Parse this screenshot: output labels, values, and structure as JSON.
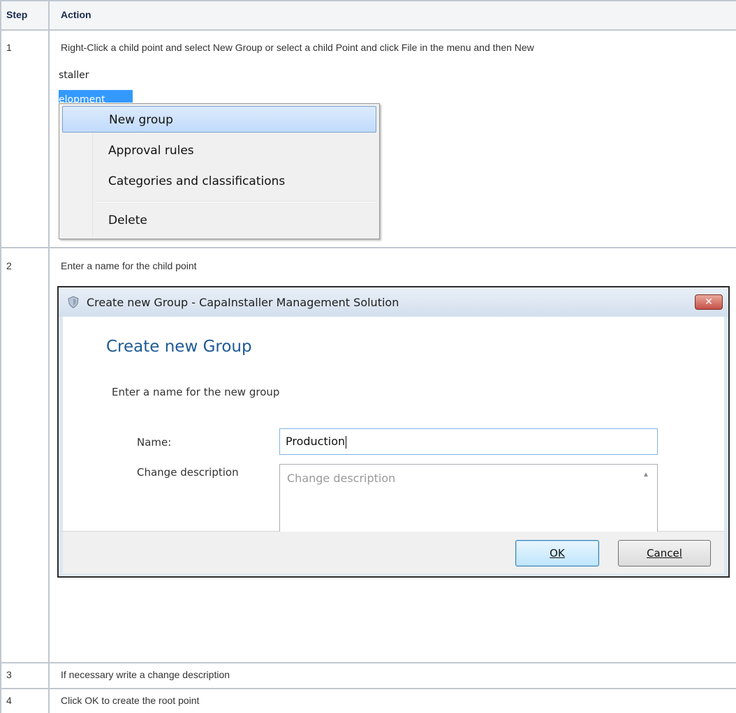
{
  "table": {
    "headers": {
      "step": "Step",
      "action": "Action"
    },
    "rows": [
      {
        "step": "1",
        "action": "Right-Click a child point and select New Group or select a child Point and click File in the menu and then New"
      },
      {
        "step": "2",
        "action": "Enter a name for the child point"
      },
      {
        "step": "3",
        "action": "If necessary write a change description"
      },
      {
        "step": "4",
        "action": "Click OK to create the root point"
      }
    ]
  },
  "step1_screenshot": {
    "tree_partial_text": "staller",
    "tree_selected_partial": "elopment",
    "menu": {
      "items": [
        "New group",
        "Approval rules",
        "Categories and classifications",
        "Delete"
      ],
      "highlighted_index": 0
    }
  },
  "step2_screenshot": {
    "window_title": "Create new Group - CapaInstaller Management Solution",
    "close_glyph": "✕",
    "heading": "Create new Group",
    "instruction": "Enter a name for the new group",
    "name_label": "Name:",
    "name_value": "Production",
    "description_label": "Change description",
    "description_placeholder": "Change description",
    "ok_label": "OK",
    "cancel_label": "Cancel",
    "icon": "shield-icon"
  },
  "colors": {
    "table_border": "#c1c7d0",
    "header_bg": "#f4f5f7",
    "heading_blue": "#1e5a96",
    "menu_highlight": "#c1dbfc"
  }
}
